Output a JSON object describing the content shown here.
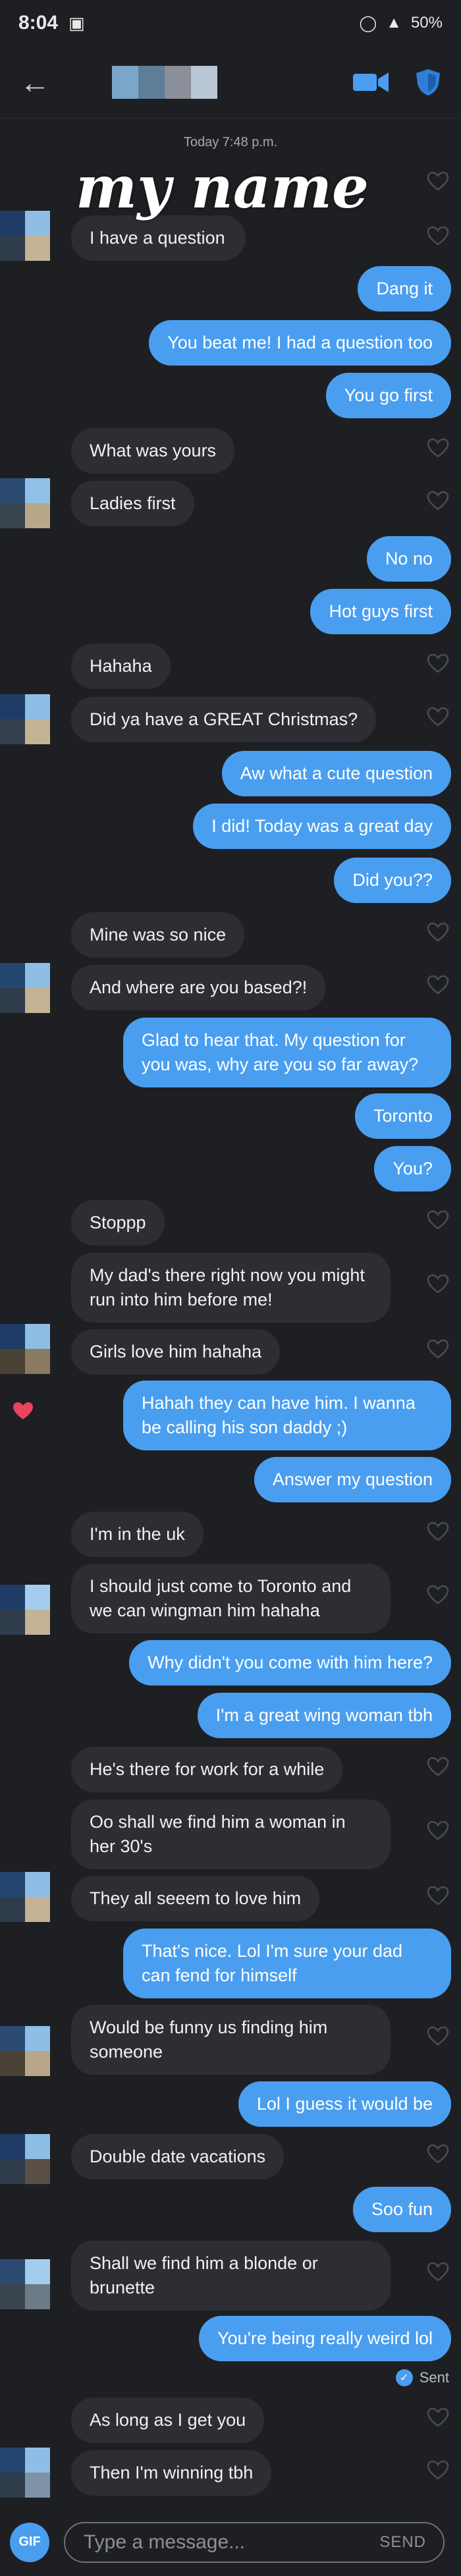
{
  "status_bar": {
    "time": "8:04",
    "battery": "50%"
  },
  "header": {
    "back_icon": "back-arrow-icon",
    "video_icon": "video-call-icon",
    "safety_icon": "shield-icon"
  },
  "day_stamp": "Today 7:48 p.m.",
  "name_overlay": "my name",
  "messages": [
    {
      "dir": "in",
      "text": "I have a question"
    },
    {
      "dir": "out",
      "text": "Dang it"
    },
    {
      "dir": "out",
      "text": "You beat me! I had a question too"
    },
    {
      "dir": "out",
      "text": "You go first"
    },
    {
      "dir": "in",
      "text": "What was yours"
    },
    {
      "dir": "in",
      "text": "Ladies first"
    },
    {
      "dir": "out",
      "text": "No no"
    },
    {
      "dir": "out",
      "text": "Hot guys first"
    },
    {
      "dir": "in",
      "text": "Hahaha"
    },
    {
      "dir": "in",
      "text": "Did ya have a GREAT Christmas?"
    },
    {
      "dir": "out",
      "text": "Aw what a cute question"
    },
    {
      "dir": "out",
      "text": "I did! Today was a great day"
    },
    {
      "dir": "out",
      "text": "Did you??"
    },
    {
      "dir": "in",
      "text": "Mine was so nice"
    },
    {
      "dir": "in",
      "text": "And where are you based?!"
    },
    {
      "dir": "out",
      "text": "Glad to hear that. My question for you was, why are you so far away?"
    },
    {
      "dir": "out",
      "text": "Toronto"
    },
    {
      "dir": "out",
      "text": "You?"
    },
    {
      "dir": "in",
      "text": "Stoppp"
    },
    {
      "dir": "in",
      "text": "My dad's there right now you might run into him before me!"
    },
    {
      "dir": "in",
      "text": "Girls love him hahaha"
    },
    {
      "dir": "out",
      "text": "Hahah they can have him. I wanna be calling his son daddy ;)"
    },
    {
      "dir": "out",
      "text": "Answer my question"
    },
    {
      "dir": "in",
      "text": "I'm in the uk"
    },
    {
      "dir": "in",
      "text": "I should just come to Toronto and we can wingman him hahaha"
    },
    {
      "dir": "out",
      "text": "Why didn't you come with him here?"
    },
    {
      "dir": "out",
      "text": "I'm a great wing woman tbh"
    },
    {
      "dir": "in",
      "text": "He's there for work for a while"
    },
    {
      "dir": "in",
      "text": "Oo shall we find him a woman in her 30's"
    },
    {
      "dir": "in",
      "text": "They all seeem to love him"
    },
    {
      "dir": "out",
      "text": "That's nice. Lol I'm sure your dad can fend for himself"
    },
    {
      "dir": "in",
      "text": "Would be funny us finding him someone"
    },
    {
      "dir": "out",
      "text": "Lol I guess it would be"
    },
    {
      "dir": "in",
      "text": "Double date vacations"
    },
    {
      "dir": "out",
      "text": "Soo fun"
    },
    {
      "dir": "in",
      "text": "Shall we find him a blonde or brunette"
    },
    {
      "dir": "out",
      "text": "You're being really weird lol"
    },
    {
      "dir": "in",
      "text": "As long as I get you"
    },
    {
      "dir": "in",
      "text": "Then I'm winning tbh"
    }
  ],
  "sent_label": "Sent",
  "composer": {
    "gif_label": "GIF",
    "placeholder": "Type a message...",
    "send_label": "SEND"
  },
  "colors": {
    "accent": "#4a9ef0",
    "background": "#1e1f22",
    "incoming_bubble": "#2c2e33",
    "liked_heart": "#e8455d"
  }
}
